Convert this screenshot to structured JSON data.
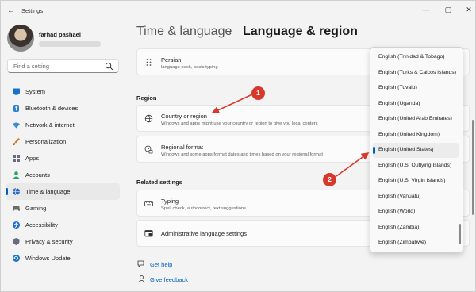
{
  "window": {
    "title": "Settings",
    "back_glyph": "←",
    "minimize_glyph": "—",
    "maximize_glyph": "▢",
    "close_glyph": "✕"
  },
  "profile": {
    "name": "farhad pashaei"
  },
  "search": {
    "placeholder": "Find a setting"
  },
  "nav": {
    "items": [
      {
        "label": "System",
        "icon": "system-icon",
        "color": "#1a73c8"
      },
      {
        "label": "Bluetooth & devices",
        "icon": "bluetooth-icon",
        "color": "#2a7fcf"
      },
      {
        "label": "Network & internet",
        "icon": "wifi-icon",
        "color": "#3d8ad6"
      },
      {
        "label": "Personalization",
        "icon": "brush-icon",
        "color": "#d17a26"
      },
      {
        "label": "Apps",
        "icon": "apps-icon",
        "color": "#6b6b7b"
      },
      {
        "label": "Accounts",
        "icon": "accounts-icon",
        "color": "#2aa06b"
      },
      {
        "label": "Time & language",
        "icon": "globe-clock-icon",
        "color": "#2a6fbf"
      },
      {
        "label": "Gaming",
        "icon": "gaming-icon",
        "color": "#6b6b6b"
      },
      {
        "label": "Accessibility",
        "icon": "accessibility-icon",
        "color": "#1f6fd1"
      },
      {
        "label": "Privacy & security",
        "icon": "shield-icon",
        "color": "#6b6b7b"
      },
      {
        "label": "Windows Update",
        "icon": "update-icon",
        "color": "#1a73c8"
      }
    ],
    "active_index": 6
  },
  "header": {
    "parent": "Time & language",
    "separator": "›",
    "current": "Language & region"
  },
  "language_card": {
    "title": "Persian",
    "subtitle": "language pack, basic typing"
  },
  "region": {
    "section": "Region",
    "country": {
      "title": "Country or region",
      "subtitle": "Windows and apps might use your country or region to give you local content"
    },
    "format": {
      "title": "Regional format",
      "subtitle": "Windows and some apps format dates and times based on your regional format"
    }
  },
  "related": {
    "section": "Related settings",
    "typing": {
      "title": "Typing",
      "subtitle": "Spell check, autocorrect, text suggestions"
    },
    "admin": {
      "title": "Administrative language settings"
    }
  },
  "links": {
    "help": "Get help",
    "feedback": "Give feedback"
  },
  "dropdown": {
    "options": [
      "English (Trinidad & Tobago)",
      "English (Turks & Caicos Islands)",
      "English (Tuvalu)",
      "English (Uganda)",
      "English (United Arab Emirates)",
      "English (United Kingdom)",
      "English (United States)",
      "English (U.S. Outlying Islands)",
      "English (U.S. Virgin Islands)",
      "English (Vanuatu)",
      "English (World)",
      "English (Zambia)",
      "English (Zimbabwe)"
    ],
    "selected_index": 6
  },
  "annotations": {
    "badge1": "1",
    "badge2": "2",
    "color": "#d6392c"
  },
  "accent_color": "#005fb8"
}
